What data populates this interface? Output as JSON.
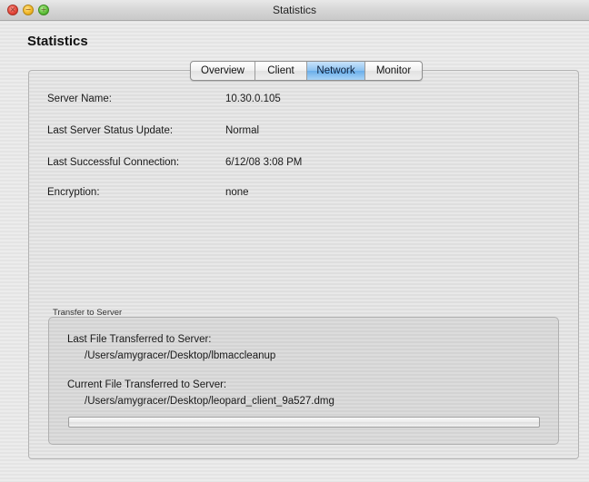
{
  "window": {
    "title": "Statistics"
  },
  "page": {
    "heading": "Statistics"
  },
  "tabs": [
    {
      "label": "Overview",
      "selected": false
    },
    {
      "label": "Client",
      "selected": false
    },
    {
      "label": "Network",
      "selected": true
    },
    {
      "label": "Monitor",
      "selected": false
    }
  ],
  "fields": [
    {
      "label": "Server Name:",
      "value": "10.30.0.105"
    },
    {
      "label": "Last Server Status Update:",
      "value": "Normal"
    },
    {
      "label": "Last Successful Connection:",
      "value": "6/12/08 3:08 PM"
    },
    {
      "label": "Encryption:",
      "value": "none"
    }
  ],
  "transfer": {
    "group_title": "Transfer to Server",
    "last_file_label": "Last File Transferred to Server:",
    "last_file_path": "/Users/amygracer/Desktop/lbmaccleanup",
    "current_file_label": "Current File Transferred to Server:",
    "current_file_path": "/Users/amygracer/Desktop/leopard_client_9a527.dmg",
    "progress_fraction": 0
  },
  "colors": {
    "selected_tab": "#8cc2f1",
    "close_button": "#e5473a",
    "minimize_button": "#f2b827",
    "zoom_button": "#5fc23b"
  },
  "icons": {
    "close": "close-icon",
    "minimize": "minimize-icon",
    "zoom": "zoom-icon"
  }
}
